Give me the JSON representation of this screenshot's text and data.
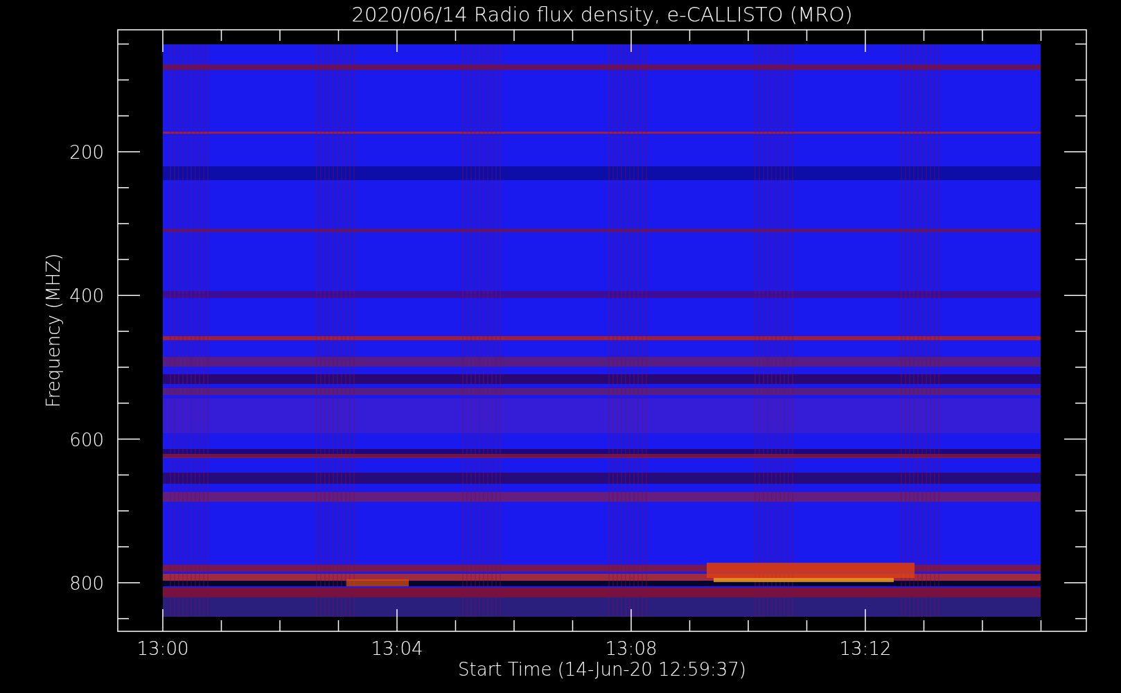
{
  "title": "2020/06/14  Radio flux density, e-CALLISTO (MRO)",
  "plot": {
    "ylabel": "Frequency (MHZ)",
    "xlabel": "Start Time (14-Jun-20 12:59:37)",
    "yticks": [
      "200",
      "400",
      "600",
      "800"
    ],
    "xticks": [
      "13:00",
      "13:04",
      "13:08",
      "13:12"
    ]
  }
}
